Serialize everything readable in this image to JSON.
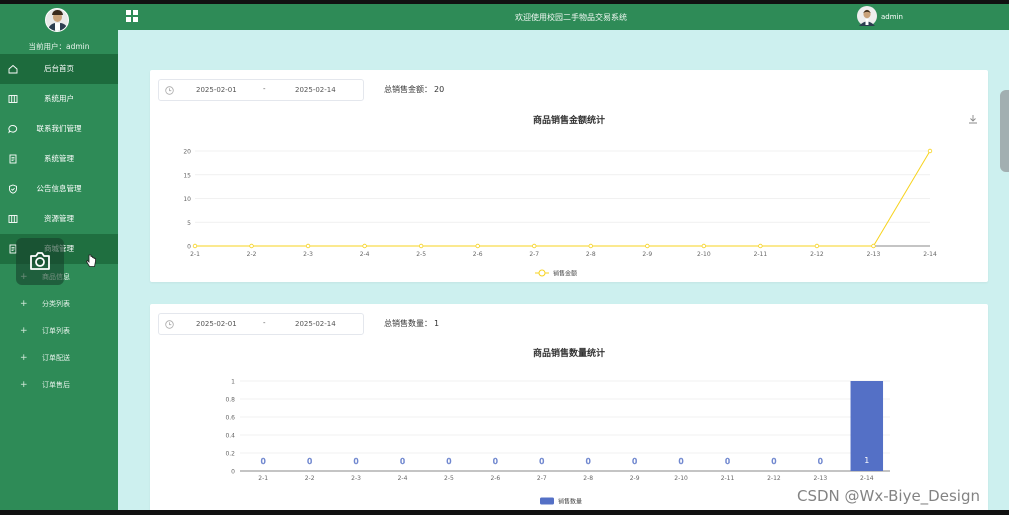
{
  "sidebar": {
    "user_label": "当前用户：admin",
    "items": [
      {
        "label": "后台首页",
        "icon": "home-icon",
        "active": true
      },
      {
        "label": "系统用户",
        "icon": "columns-icon"
      },
      {
        "label": "联系我们管理",
        "icon": "chat-icon"
      },
      {
        "label": "系统管理",
        "icon": "document-icon"
      },
      {
        "label": "公告信息管理",
        "icon": "shield-icon"
      },
      {
        "label": "资源管理",
        "icon": "columns-icon"
      },
      {
        "label": "商城管理",
        "icon": "document-icon"
      }
    ],
    "sub_items": [
      {
        "label": "商品信息"
      },
      {
        "label": "分类列表"
      },
      {
        "label": "订单列表"
      },
      {
        "label": "订单配送"
      },
      {
        "label": "订单售后"
      }
    ]
  },
  "header": {
    "title": "欢迎使用校园二手物品交易系统",
    "username": "admin"
  },
  "card1": {
    "start_date": "2025-02-01",
    "range_sep": "-",
    "end_date": "2025-02-14",
    "summary_label": "总销售金额：",
    "summary_value": "20"
  },
  "card2": {
    "start_date": "2025-02-01",
    "range_sep": "-",
    "end_date": "2025-02-14",
    "summary_label": "总销售数量：",
    "summary_value": "1"
  },
  "watermark": "CSDN @Wx-Biye_Design",
  "colors": {
    "sidebar": "#2e8b57",
    "content_bg": "#cdf0ef",
    "line": "#f7d31f",
    "bar": "#5470c6"
  },
  "chart_data": [
    {
      "type": "line",
      "title": "商品销售金额统计",
      "categories": [
        "2-1",
        "2-2",
        "2-3",
        "2-4",
        "2-5",
        "2-6",
        "2-7",
        "2-8",
        "2-9",
        "2-10",
        "2-11",
        "2-12",
        "2-13",
        "2-14"
      ],
      "series": [
        {
          "name": "销售金额",
          "values": [
            0,
            0,
            0,
            0,
            0,
            0,
            0,
            0,
            0,
            0,
            0,
            0,
            0,
            20
          ]
        }
      ],
      "yticks": [
        "0",
        "5",
        "10",
        "15",
        "20"
      ],
      "ylim": [
        0,
        20
      ],
      "grid": true,
      "legend": "bottom-center"
    },
    {
      "type": "bar",
      "title": "商品销售数量统计",
      "categories": [
        "2-1",
        "2-2",
        "2-3",
        "2-4",
        "2-5",
        "2-6",
        "2-7",
        "2-8",
        "2-9",
        "2-10",
        "2-11",
        "2-12",
        "2-13",
        "2-14"
      ],
      "series": [
        {
          "name": "销售数量",
          "values": [
            0,
            0,
            0,
            0,
            0,
            0,
            0,
            0,
            0,
            0,
            0,
            0,
            0,
            1
          ]
        }
      ],
      "yticks": [
        "0",
        "0.2",
        "0.4",
        "0.6",
        "0.8",
        "1"
      ],
      "ylim": [
        0,
        1
      ],
      "data_labels": true,
      "grid": true,
      "legend": "bottom-center"
    }
  ]
}
